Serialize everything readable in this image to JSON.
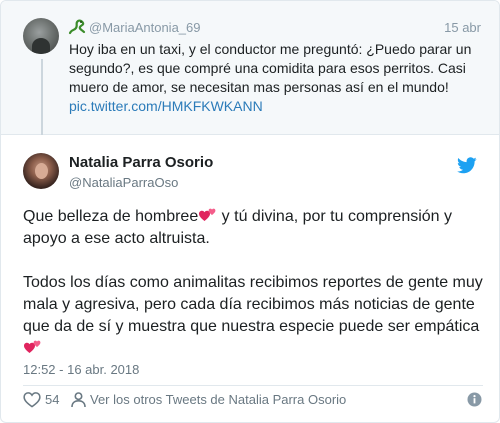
{
  "parent_tweet": {
    "handle": "@MariaAntonia_69",
    "date": "15 abr",
    "text": "Hoy iba en un taxi, y el conductor me preguntó: ¿Puedo parar un segundo?, es que compré una comidita para esos perritos. Casi muero de amor, se necesitan mas personas así en el mundo!",
    "link": "pic.twitter.com/HMKFKWKANN",
    "badge_icon": "lizard-icon"
  },
  "tweet": {
    "name": "Natalia Parra Osorio",
    "handle": "@NataliaParraOso",
    "paragraph1_a": "Que belleza de hombree",
    "paragraph1_b": " y tú divina, por tu comprensión y apoyo a ese acto altruista.",
    "paragraph2": "Todos los días como animalitas recibimos reportes de gente muy mala y agresiva, pero cada día recibimos más noticias de gente que da de sí y muestra que nuestra especie puede ser empática",
    "timestamp": "12:52 - 16 abr. 2018",
    "likes": "54",
    "more_link": "Ver los otros Tweets de Natalia Parra Osorio",
    "emoji_icon": "two-hearts-icon"
  },
  "colors": {
    "brand_blue": "#1da1f2",
    "link_blue": "#2b7bb9",
    "text": "#1c2022",
    "muted": "#697882",
    "heart_pink": "#e0245e"
  }
}
